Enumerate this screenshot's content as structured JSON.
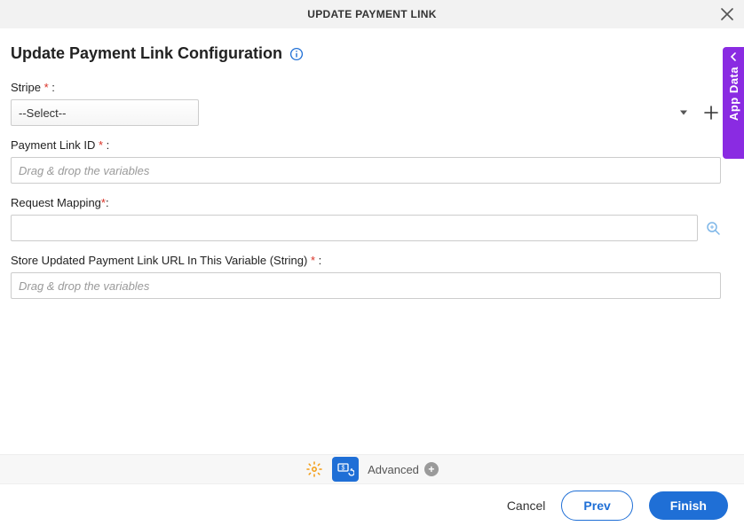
{
  "header": {
    "title": "UPDATE PAYMENT LINK"
  },
  "page": {
    "title": "Update Payment Link Configuration"
  },
  "fields": {
    "stripe": {
      "label": "Stripe",
      "suffix": " :",
      "placeholder": "--Select--"
    },
    "payment_link_id": {
      "label": "Payment Link ID",
      "suffix": " :",
      "placeholder": "Drag & drop the variables"
    },
    "request_mapping": {
      "label": "Request Mapping",
      "suffix": ":"
    },
    "store_url": {
      "label": "Store Updated Payment Link URL In This Variable (String)",
      "suffix": " :",
      "placeholder": "Drag & drop the variables"
    }
  },
  "sidebar": {
    "app_data": "App Data"
  },
  "toolbar": {
    "advanced": "Advanced"
  },
  "footer": {
    "cancel": "Cancel",
    "prev": "Prev",
    "finish": "Finish"
  }
}
